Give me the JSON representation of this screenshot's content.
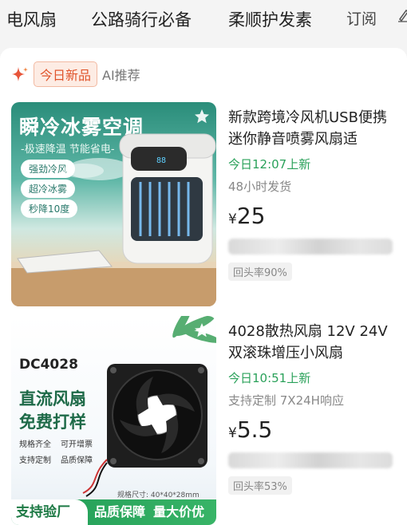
{
  "nav": {
    "categories": [
      "电风扇",
      "公路骑行必备",
      "柔顺护发素"
    ],
    "subscribe_label": "订阅"
  },
  "tabs": {
    "active": "今日新品",
    "ai": "AI推荐"
  },
  "products": [
    {
      "image_text": {
        "title": "瞬冷冰雾空调",
        "subtitle": "-极速降温 节能省电-",
        "features": [
          "强劲冷风",
          "超冷冰雾",
          "秒降10度"
        ]
      },
      "title": "新款跨境冷风机USB便携迷你静音喷雾风扇适",
      "new_label": "今日12:07上新",
      "meta": "48小时发货",
      "price_currency": "¥",
      "price": "25",
      "repeat_rate": "回头率90%"
    },
    {
      "image_text": {
        "model": "DC4028",
        "headline1": "直流风扇",
        "headline2": "免费打样",
        "features": [
          "规格齐全",
          "可开增票",
          "支持定制",
          "品质保障"
        ],
        "spec": "规格尺寸: 40*40*28mm",
        "bottom_left": "支持验厂",
        "bottom_mid": "品质保障",
        "bottom_right": "量大价优"
      },
      "title": "4028散热风扇 12V 24V双滚珠增压小风扇",
      "new_label": "今日10:51上新",
      "meta": "支持定制 7X24H响应",
      "price_currency": "¥",
      "price": "5.5",
      "repeat_rate": "回头率53%"
    }
  ],
  "colors": {
    "accent_orange": "#e0552c",
    "new_green": "#2aa15a",
    "thumb1_teal": "#2a8d7a",
    "thumb2_green": "#1e6a48"
  },
  "icons": [
    "sparkle-icon",
    "star-icon",
    "edit-icon",
    "battery-fan-product-image",
    "cpu-fan-product-image"
  ]
}
